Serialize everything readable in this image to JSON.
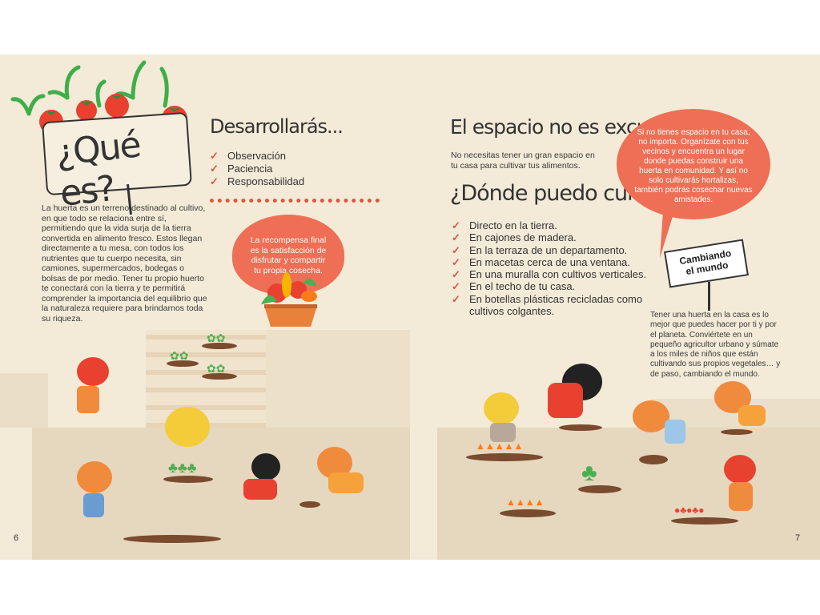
{
  "left_page": {
    "title": "¿Qué es?",
    "intro": "La huerta es un terreno destinado al cultivo, en que todo se relaciona entre sí, permitiendo que la vida surja de la tierra convertida en alimento fresco. Estos llegan directamente a tu mesa, con todos los nutrientes que tu cuerpo necesita, sin camiones, supermercados, bodegas o bolsas de por medio. Tener tu propio huerto te conectará con la tierra y te permitirá comprender la importancia del equilibrio que la naturaleza requiere para brindarnos toda su riqueza.",
    "develop_heading": "Desarrollarás...",
    "develop_items": [
      "Observación",
      "Paciencia",
      "Responsabilidad"
    ],
    "reward_bubble": "La recompensa final es la satisfacción de disfrutar y compartir tu propia cosecha.",
    "page_number": "6"
  },
  "right_page": {
    "space_heading": "El espacio no es excusa",
    "space_text": "No necesitas tener un gran espacio en tu casa para cultivar tus alimentos.",
    "where_heading": "¿Dónde puedo cultivar?",
    "where_items": [
      "Directo en la tierra.",
      "En cajones de madera.",
      "En la terraza de un departamento.",
      "En macetas cerca de una ventana.",
      "En una muralla con cultivos verticales.",
      "En el techo de tu casa.",
      "En botellas plásticas recicladas como cultivos colgantes."
    ],
    "speech_bubble": "Si no tienes espacio en tu casa, no importa. Organízate con tus vecinos y encuentra un lugar donde puedas construir una huerta en comunidad. Y así no solo cultivarás hortalizas, también podrás cosechar nuevas amistades.",
    "sign_text": "Cambiando el mundo",
    "closing_text": "Tener una huerta en la casa es lo mejor que puedes hacer por ti y por el planeta. Conviértete en un pequeño agricultor urbano y súmate a los miles de niños que están cultivando sus propios vegetales… y de paso, cambiando el mundo.",
    "page_number": "7"
  },
  "icons": [
    "check-icon",
    "tomato-plant-icon",
    "vegetable-basket-icon",
    "plant-icon"
  ],
  "colors": {
    "paper": "#f3ead8",
    "accent": "#e0553d",
    "bubble": "#ee6f55",
    "ground": "#e6d7bf",
    "soil": "#7a4b2e"
  }
}
